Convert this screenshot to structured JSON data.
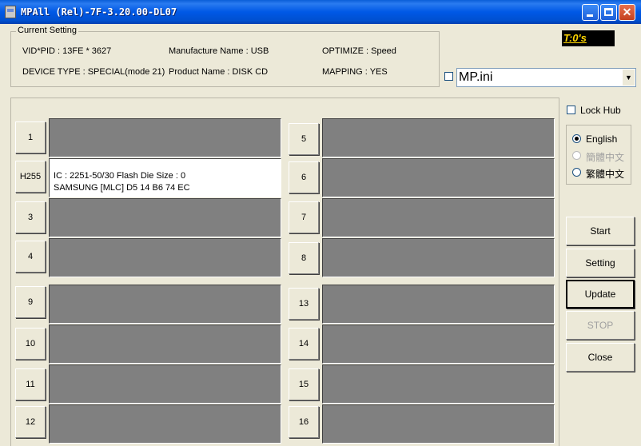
{
  "window": {
    "title": "MPAll (Rel)-7F-3.20.00-DL07"
  },
  "current_setting": {
    "legend": "Current Setting",
    "vid_pid": "VID*PID : 13FE * 3627",
    "manufacture_name": "Manufacture Name : USB",
    "optimize": "OPTIMIZE : Speed",
    "device_type": "DEVICE TYPE : SPECIAL(mode 21)",
    "product_name": "Product Name : DISK CD",
    "mapping": "MAPPING : YES"
  },
  "timer": "T:0's",
  "ini_file": {
    "checked": false,
    "value": "MP.ini"
  },
  "lock_hub": {
    "label": "Lock Hub",
    "checked": false
  },
  "languages": [
    {
      "label": "English",
      "selected": true,
      "enabled": true
    },
    {
      "label": "簡體中文",
      "selected": false,
      "enabled": false
    },
    {
      "label": "繁體中文",
      "selected": false,
      "enabled": true
    }
  ],
  "buttons": {
    "start": "Start",
    "setting": "Setting",
    "update": "Update",
    "stop": "STOP",
    "close": "Close"
  },
  "slots_left": [
    {
      "label": "1",
      "lines": []
    },
    {
      "label": "H255",
      "lines": [
        "IC : 2251-50/30  Flash Die Size : 0",
        "SAMSUNG [MLC] D5 14 B6 74 EC"
      ]
    },
    {
      "label": "3",
      "lines": []
    },
    {
      "label": "4",
      "lines": []
    },
    {
      "label": "9",
      "lines": []
    },
    {
      "label": "10",
      "lines": []
    },
    {
      "label": "11",
      "lines": []
    },
    {
      "label": "12",
      "lines": []
    }
  ],
  "slots_right": [
    {
      "label": "5"
    },
    {
      "label": "6"
    },
    {
      "label": "7"
    },
    {
      "label": "8"
    },
    {
      "label": "13"
    },
    {
      "label": "14"
    },
    {
      "label": "15"
    },
    {
      "label": "16"
    }
  ]
}
